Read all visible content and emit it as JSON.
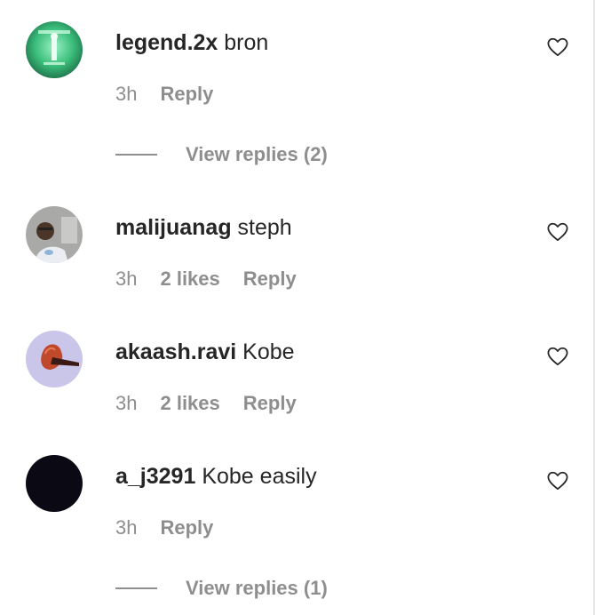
{
  "comments": [
    {
      "username": "legend.2x",
      "text": "bron",
      "time": "3h",
      "likes": "",
      "reply_label": "Reply",
      "view_replies": "View replies (2)"
    },
    {
      "username": "malijuanag",
      "text": "steph",
      "time": "3h",
      "likes": "2 likes",
      "reply_label": "Reply",
      "view_replies": ""
    },
    {
      "username": "akaash.ravi",
      "text": "Kobe",
      "time": "3h",
      "likes": "2 likes",
      "reply_label": "Reply",
      "view_replies": ""
    },
    {
      "username": "a_j3291",
      "text": "Kobe easily",
      "time": "3h",
      "likes": "",
      "reply_label": "Reply",
      "view_replies": "View replies (1)"
    }
  ],
  "icons": {
    "like": "heart-outline-icon"
  },
  "colors": {
    "text_primary": "#262626",
    "text_secondary": "#8e8e8e",
    "background": "#ffffff"
  }
}
